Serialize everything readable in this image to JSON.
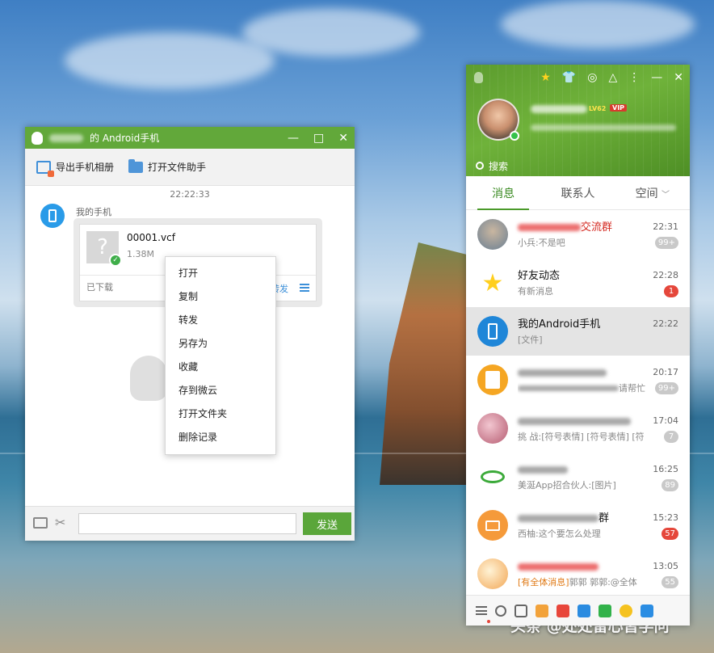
{
  "desktop": {
    "watermark": "头条 @处处留心皆学问"
  },
  "chat_window": {
    "title": "的 Android手机",
    "controls": {
      "minimize": "—",
      "maximize": "□",
      "close": "✕"
    },
    "toolbar": {
      "export_album": "导出手机相册",
      "open_file_helper": "打开文件助手"
    },
    "timestamp": "22:22:33",
    "sender": "我的手机",
    "file": {
      "thumb_glyph": "?",
      "name": "00001.vcf",
      "size": "1.38M",
      "status": "已下载",
      "open": "打开",
      "copy": "复制",
      "forward": "转发"
    },
    "context_menu": [
      "打开",
      "复制",
      "转发",
      "另存为",
      "收藏",
      "存到微云",
      "打开文件夹",
      "删除记录"
    ],
    "input": {
      "value": "",
      "placeholder": ""
    },
    "send_label": "发送"
  },
  "qq_panel": {
    "header": {
      "level": "LV62",
      "vip": "VIP",
      "search_placeholder": "搜索",
      "icons": [
        "qq-penguin-icon",
        "star-icon",
        "skin-icon",
        "coin-icon",
        "app-icon",
        "more-icon"
      ]
    },
    "tabs": [
      {
        "label": "消息",
        "active": true
      },
      {
        "label": "联系人",
        "active": false
      },
      {
        "label": "空间",
        "active": false
      }
    ],
    "conversations": [
      {
        "name_suffix": "交流群",
        "preview": "小兵:不是吧",
        "time": "22:31",
        "badge": "99+",
        "badge_color": "grey",
        "avatar_color": "#7d8a9a"
      },
      {
        "name": "好友动态",
        "preview": "有新消息",
        "time": "22:28",
        "badge": "1",
        "badge_color": "red",
        "avatar_color": "#ffd21f"
      },
      {
        "name": "我的Android手机",
        "preview": "[文件]",
        "time": "22:22",
        "badge": "",
        "badge_color": "",
        "avatar_color": "#1f86d8"
      },
      {
        "name_suffix": "",
        "preview_suffix": "请帮忙",
        "time": "20:17",
        "badge": "99+",
        "badge_color": "grey",
        "avatar_color": "#f5a623"
      },
      {
        "name_suffix": "",
        "preview": "挑 战:[符号表情] [符号表情] [符",
        "time": "17:04",
        "badge": "7",
        "badge_color": "grey",
        "avatar_color": "#c96a7e"
      },
      {
        "name_suffix": "",
        "preview": "美涎App招合伙人:[图片]",
        "time": "16:25",
        "badge": "89",
        "badge_color": "grey",
        "avatar_color": "#ffffff"
      },
      {
        "name_suffix": "群",
        "preview": "西柚:这个要怎么处理",
        "time": "15:23",
        "badge": "57",
        "badge_color": "red",
        "avatar_color": "#f59a3a"
      },
      {
        "name_suffix": "",
        "preview_tag": "[有全体消息]",
        "preview": "郭郭",
        "preview_tail": "郭郭:@全体",
        "time": "13:05",
        "badge": "55",
        "badge_color": "grey",
        "avatar_color": "#f7b26a"
      }
    ],
    "footer_icons": [
      "main-menu-icon",
      "add-friend-icon",
      "apps-icon",
      "game-icon",
      "video-icon",
      "weiyun-icon",
      "live-icon",
      "wallet-icon",
      "app-manager-icon"
    ]
  }
}
